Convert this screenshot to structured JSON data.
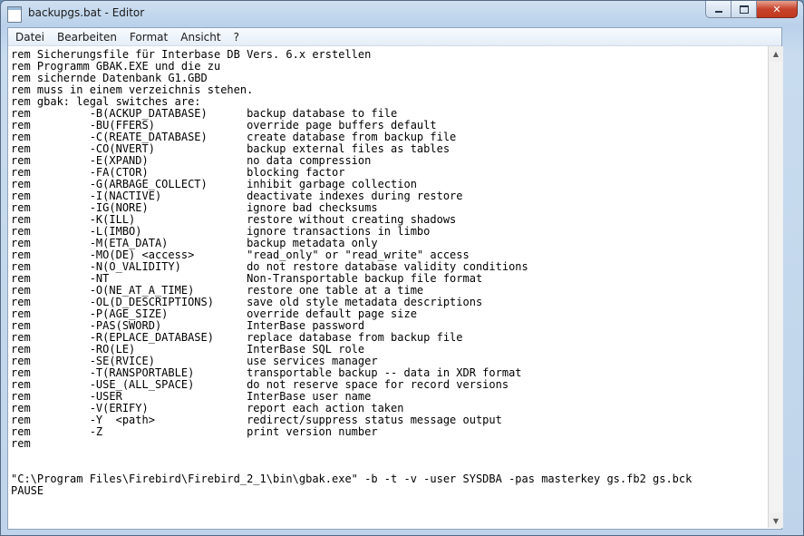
{
  "window": {
    "title": "backupgs.bat - Editor",
    "buttons": {
      "minimize": "minimize-icon",
      "maximize": "maximize-icon",
      "close": "✕"
    }
  },
  "menu": [
    "Datei",
    "Bearbeiten",
    "Format",
    "Ansicht",
    "?"
  ],
  "editor": {
    "content": "rem Sicherungsfile für Interbase DB Vers. 6.x erstellen\nrem Programm GBAK.EXE und die zu\nrem sichernde Datenbank G1.GBD\nrem muss in einem verzeichnis stehen.\nrem gbak: legal switches are:\nrem         -B(ACKUP_DATABASE)      backup database to file\nrem         -BU(FFERS)              override page buffers default\nrem         -C(REATE_DATABASE)      create database from backup file\nrem         -CO(NVERT)              backup external files as tables\nrem         -E(XPAND)               no data compression\nrem         -FA(CTOR)               blocking factor\nrem         -G(ARBAGE_COLLECT)      inhibit garbage collection\nrem         -I(NACTIVE)             deactivate indexes during restore\nrem         -IG(NORE)               ignore bad checksums\nrem         -K(ILL)                 restore without creating shadows\nrem         -L(IMBO)                ignore transactions in limbo\nrem         -M(ETA_DATA)            backup metadata only\nrem         -MO(DE) <access>        \"read_only\" or \"read_write\" access\nrem         -N(O_VALIDITY)          do not restore database validity conditions\nrem         -NT                     Non-Transportable backup file format\nrem         -O(NE_AT_A_TIME)        restore one table at a time\nrem         -OL(D_DESCRIPTIONS)     save old style metadata descriptions\nrem         -P(AGE_SIZE)            override default page size\nrem         -PAS(SWORD)             InterBase password\nrem         -R(EPLACE_DATABASE)     replace database from backup file\nrem         -RO(LE)                 InterBase SQL role\nrem         -SE(RVICE)              use services manager\nrem         -T(RANSPORTABLE)        transportable backup -- data in XDR format\nrem         -USE_(ALL_SPACE)        do not reserve space for record versions\nrem         -USER                   InterBase user name\nrem         -V(ERIFY)               report each action taken\nrem         -Y  <path>              redirect/suppress status message output\nrem         -Z                      print version number\nrem\n\n\n\"C:\\Program Files\\Firebird\\Firebird_2_1\\bin\\gbak.exe\" -b -t -v -user SYSDBA -pas masterkey gs.fb2 gs.bck\nPAUSE"
  },
  "scrollbar": {
    "up": "▲",
    "down": "▼"
  }
}
